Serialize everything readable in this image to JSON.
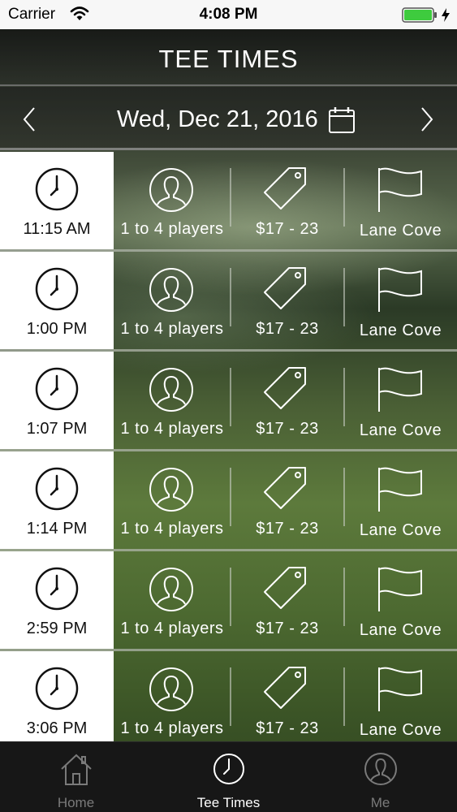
{
  "status": {
    "carrier": "Carrier",
    "time": "4:08 PM",
    "battery_color": "#3ecb3e"
  },
  "header": {
    "title": "TEE TIMES"
  },
  "date_bar": {
    "date": "Wed, Dec 21, 2016"
  },
  "tee_times": [
    {
      "time": "11:15 AM",
      "players": "1 to 4 players",
      "price": "$17 - 23",
      "course": "Lane Cove"
    },
    {
      "time": "1:00 PM",
      "players": "1 to 4 players",
      "price": "$17 - 23",
      "course": "Lane Cove"
    },
    {
      "time": "1:07 PM",
      "players": "1 to 4 players",
      "price": "$17 - 23",
      "course": "Lane Cove"
    },
    {
      "time": "1:14 PM",
      "players": "1 to 4 players",
      "price": "$17 - 23",
      "course": "Lane Cove"
    },
    {
      "time": "2:59 PM",
      "players": "1 to 4 players",
      "price": "$17 - 23",
      "course": "Lane Cove"
    },
    {
      "time": "3:06 PM",
      "players": "1 to 4 players",
      "price": "$17 - 23",
      "course": "Lane Cove"
    }
  ],
  "tabs": [
    {
      "label": "Home",
      "icon": "home-icon",
      "active": false
    },
    {
      "label": "Tee Times",
      "icon": "clock-icon",
      "active": true
    },
    {
      "label": "Me",
      "icon": "user-icon",
      "active": false
    }
  ]
}
